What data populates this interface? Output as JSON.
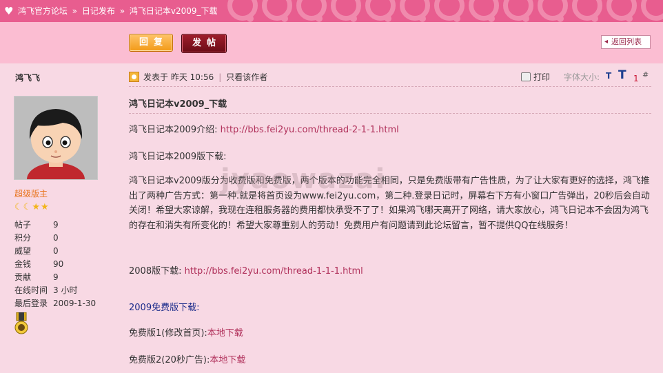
{
  "breadcrumb": {
    "items": [
      "鸿飞官方论坛",
      "日记发布",
      "鸿飞日记本v2009_下载"
    ],
    "separator": "»"
  },
  "toolbar": {
    "reply_label": "回复",
    "post_label": "发帖",
    "back_label": "返回列表"
  },
  "user": {
    "name": "鸿飞飞",
    "rank": "超级版主",
    "stats": [
      {
        "key": "帖子",
        "value": "9"
      },
      {
        "key": "积分",
        "value": "0"
      },
      {
        "key": "威望",
        "value": "0"
      },
      {
        "key": "金钱",
        "value": "90"
      },
      {
        "key": "贡献",
        "value": "9"
      },
      {
        "key": "在线时间",
        "value": "3 小时"
      },
      {
        "key": "最后登录",
        "value": "2009-1-30"
      }
    ]
  },
  "post": {
    "posted_at": "发表于 昨天 10:56",
    "only_author": "只看该作者",
    "print_label": "打印",
    "font_size_label": "字体大小:",
    "font_small": "T",
    "font_large": "T",
    "floor": "1",
    "hash": "#",
    "title": "鸿飞日记本v2009_下载",
    "intro_label": "鸿飞日记本2009介绍:",
    "intro_link": "http://bbs.fei2yu.com/thread-2-1-1.html",
    "download_heading": "鸿飞日记本2009版下载:",
    "body": "鸿飞日记本v2009版分为收费版和免费版，两个版本的功能完全相同，只是免费版带有广告性质，为了让大家有更好的选择，鸿飞推出了两种广告方式：第一种.就是将首页设为www.fei2yu.com，第二种.登录日记时，屏幕右下方有小窗口广告弹出，20秒后会自动关闭！希望大家谅解，我现在连租服务器的费用都快承受不了了！如果鸿飞哪天离开了网络，请大家放心，鸿飞日记本不会因为鸿飞的存在和消失有所变化的！希望大家尊重别人的劳动！免费用户有问题请到此论坛留言，暂不提供QQ在线服务！",
    "v2008_label": "2008版下载:",
    "v2008_link": "http://bbs.fei2yu.com/thread-1-1-1.html",
    "free_heading": "2009免费版下载:",
    "free1_label": "免费版1(修改首页):",
    "free1_link": "本地下载",
    "free2_label": "免费版2(20秒广告):",
    "free2_link": "本地下载"
  },
  "watermark": "jyaowazai"
}
